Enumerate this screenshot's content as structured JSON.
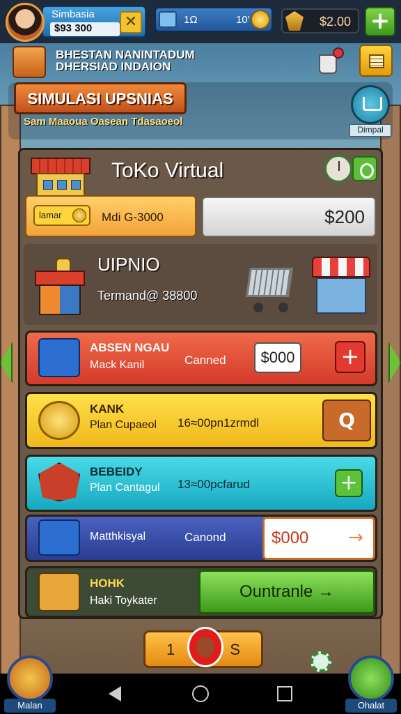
{
  "header": {
    "player_name": "Simbasia",
    "player_money": "$93 300",
    "close_symbol": "✕",
    "energy_a": "1Ω",
    "energy_b": "10'",
    "gems_value": "$2.00",
    "plus_symbol": "+"
  },
  "mission": {
    "line1": "BHESTAN NANINTADUM",
    "line2": "DHERSIAD INDAION"
  },
  "title": {
    "banner": "SIMULASI UPSNIAS",
    "subtitle": "Sam Maaoua Oasean Tdasaoeol"
  },
  "shop": {
    "label": "Dimpal"
  },
  "toko": {
    "title": "ToKo Virtual",
    "tag_label": "lamar",
    "info_text": "Mdi G-3000",
    "price": "$200"
  },
  "business": {
    "title": "UIPNIO",
    "subtitle": "Termand@ 38800"
  },
  "rows": [
    {
      "title": "ABSEN NGAU",
      "sub": "Mack Kanil",
      "mid": "Canned",
      "value": "$000",
      "button": "+",
      "color": "#e3473a"
    },
    {
      "title": "KANK",
      "sub": "Plan Cupaeol",
      "mid": "16≈00pn1zrmdl",
      "button": "Q",
      "color": "#f2c22f"
    },
    {
      "title": "BEBEIDY",
      "sub": "Plan Cantagul",
      "mid": "13≈00pcfarud",
      "button": "+",
      "color": "#2bbfd4"
    },
    {
      "sub": "Matthkisyal",
      "mid": "Canond",
      "value": "$000",
      "button": "→",
      "color": "#3a4fa8"
    },
    {
      "title": "HOHK",
      "sub": "Haki Toykater",
      "button": "Ountranle  →",
      "color": "#5cc23a"
    }
  ],
  "bottom": {
    "counter_left": "1",
    "counter_right": "S",
    "left_label": "Malan",
    "right_label": "Ohalat"
  }
}
